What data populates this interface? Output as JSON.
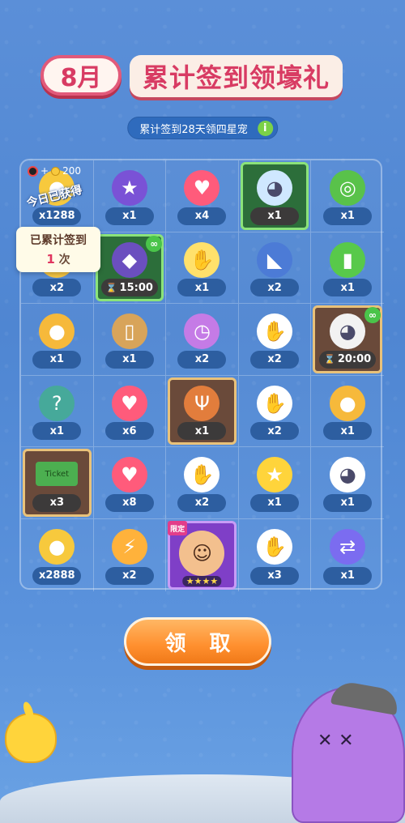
{
  "header": {
    "month": "8月",
    "title": "累计签到领壕礼",
    "subtitle": "累计签到28天领四星宠",
    "info_icon": "i"
  },
  "counter": {
    "value": "200"
  },
  "today_label": "今日已获得",
  "signed_card": {
    "line1": "已累计签到",
    "count": "1",
    "unit": "次"
  },
  "claim_button": "领 取",
  "rewards": [
    [
      {
        "name": "coin",
        "qty": "x1288",
        "style": "",
        "color": "#f7c93d",
        "glyph": "●"
      },
      {
        "name": "star-lock",
        "qty": "x1",
        "style": "",
        "color": "#7a52d6",
        "glyph": "★"
      },
      {
        "name": "heart",
        "qty": "x4",
        "style": "",
        "color": "#ff5b7b",
        "glyph": "♥"
      },
      {
        "name": "ghost-pet",
        "qty": "x1",
        "style": "green",
        "color": "#cfe8ff",
        "glyph": "◕"
      },
      {
        "name": "frog-goggles",
        "qty": "x1",
        "style": "",
        "color": "#59c24a",
        "glyph": "◎"
      }
    ],
    [
      {
        "name": "coin-bag",
        "qty": "x2",
        "style": "",
        "color": "#f5c542",
        "glyph": "●"
      },
      {
        "name": "shark-cat-pet",
        "qty": "15:00",
        "style": "green",
        "timer": true,
        "ring": true,
        "color": "#6b4fbf",
        "glyph": "◆"
      },
      {
        "name": "glove",
        "qty": "x1",
        "style": "",
        "color": "#ffe16b",
        "glyph": "✋"
      },
      {
        "name": "shark",
        "qty": "x2",
        "style": "",
        "color": "#4c7bd6",
        "glyph": "◣"
      },
      {
        "name": "green-bat",
        "qty": "x1",
        "style": "",
        "color": "#58c94a",
        "glyph": "▮"
      }
    ],
    [
      {
        "name": "egg",
        "qty": "x1",
        "style": "",
        "color": "#f6b93b",
        "glyph": "●"
      },
      {
        "name": "bucket",
        "qty": "x1",
        "style": "",
        "color": "#d8a45a",
        "glyph": "▯"
      },
      {
        "name": "clock",
        "qty": "x2",
        "style": "",
        "color": "#c57be6",
        "glyph": "◷"
      },
      {
        "name": "glove-x3",
        "qty": "x2",
        "style": "",
        "color": "#ffffff",
        "glyph": "✋"
      },
      {
        "name": "bunny-pet",
        "qty": "20:00",
        "style": "gold",
        "timer": true,
        "ring": true,
        "color": "#f2f2f2",
        "glyph": "◕"
      }
    ],
    [
      {
        "name": "mystery-bag",
        "qty": "x1",
        "style": "",
        "color": "#46a99a",
        "glyph": "?"
      },
      {
        "name": "heart",
        "qty": "x6",
        "style": "",
        "color": "#ff5b7b",
        "glyph": "♥"
      },
      {
        "name": "reindeer",
        "qty": "x1",
        "style": "gold",
        "color": "#e27d3c",
        "glyph": "Ψ"
      },
      {
        "name": "glove-x3",
        "qty": "x2",
        "style": "",
        "color": "#ffffff",
        "glyph": "✋"
      },
      {
        "name": "egg",
        "qty": "x1",
        "style": "",
        "color": "#f6b93b",
        "glyph": "●"
      }
    ],
    [
      {
        "name": "ticket",
        "qty": "x3",
        "style": "gold",
        "color": "#4caf50",
        "glyph": "Ticket"
      },
      {
        "name": "heart",
        "qty": "x8",
        "style": "",
        "color": "#ff5b7b",
        "glyph": "♥"
      },
      {
        "name": "glove-x3",
        "qty": "x2",
        "style": "",
        "color": "#ffffff",
        "glyph": "✋"
      },
      {
        "name": "star",
        "qty": "x1",
        "style": "",
        "color": "#ffd43b",
        "glyph": "★"
      },
      {
        "name": "white-bunny",
        "qty": "x1",
        "style": "",
        "color": "#ffffff",
        "glyph": "◕"
      }
    ],
    [
      {
        "name": "coin",
        "qty": "x2888",
        "style": "",
        "color": "#f7c93d",
        "glyph": "●"
      },
      {
        "name": "lightning-10",
        "qty": "x2",
        "style": "",
        "color": "#ffb23b",
        "glyph": "⚡"
      },
      {
        "name": "character-limited",
        "qty": "",
        "style": "purple",
        "limited": "限定",
        "stars": "★★★★",
        "color": "#f3c08e",
        "glyph": "☺"
      },
      {
        "name": "glove-x3",
        "qty": "x3",
        "style": "",
        "color": "#ffffff",
        "glyph": "✋"
      },
      {
        "name": "swap-arrows",
        "qty": "x1",
        "style": "",
        "color": "#7b6cf0",
        "glyph": "⇄"
      }
    ]
  ]
}
